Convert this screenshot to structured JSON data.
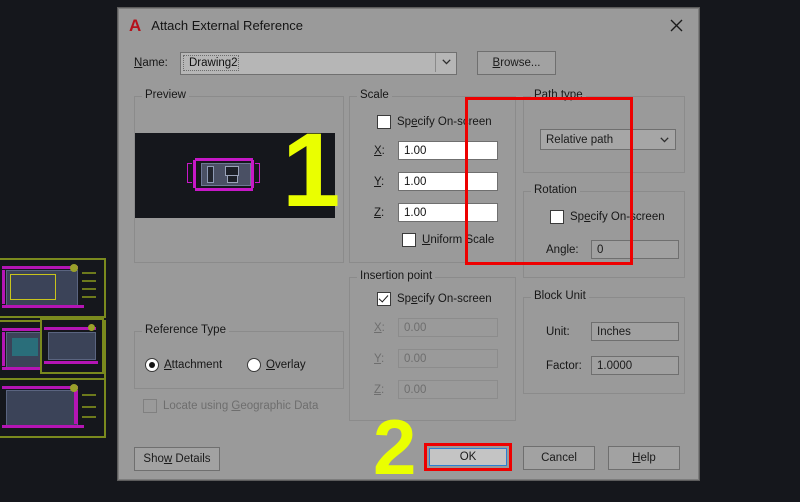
{
  "window": {
    "title": "Attach External Reference",
    "logo_letter": "A",
    "close_icon": "close-icon"
  },
  "name_row": {
    "label": "Name:",
    "label_mnemonic": "N",
    "value": "Drawing2",
    "dropdown_icon": "chevron-down-icon",
    "browse_label": "Browse...",
    "browse_mnemonic": "B"
  },
  "preview": {
    "title": "Preview"
  },
  "reference_type": {
    "title": "Reference Type",
    "attachment_label": "Attachment",
    "overlay_label": "Overlay",
    "selected": "Attachment",
    "geographic_label": "Locate using Geographic Data",
    "geographic_checked": false,
    "geographic_enabled": false
  },
  "scale": {
    "title": "Scale",
    "specify_onscreen_label": "Specify On-screen",
    "specify_onscreen_checked": false,
    "x_label": "X:",
    "x_value": "1.00",
    "y_label": "Y:",
    "y_value": "1.00",
    "z_label": "Z:",
    "z_value": "1.00",
    "uniform_scale_label": "Uniform Scale",
    "uniform_scale_checked": false
  },
  "insertion_point": {
    "title": "Insertion point",
    "specify_onscreen_label": "Specify On-screen",
    "specify_onscreen_checked": true,
    "x_label": "X:",
    "x_value": "0.00",
    "y_label": "Y:",
    "y_value": "0.00",
    "z_label": "Z:",
    "z_value": "0.00",
    "fields_enabled": false
  },
  "path_type": {
    "title": "Path type",
    "selected": "Relative path",
    "dropdown_icon": "chevron-down-icon"
  },
  "rotation": {
    "title": "Rotation",
    "specify_onscreen_label": "Specify On-screen",
    "specify_onscreen_checked": false,
    "angle_label": "Angle:",
    "angle_value": "0",
    "angle_enabled": false
  },
  "block_unit": {
    "title": "Block Unit",
    "unit_label": "Unit:",
    "unit_value": "Inches",
    "factor_label": "Factor:",
    "factor_value": "1.0000"
  },
  "footer": {
    "show_details_label": "Show Details",
    "ok_label": "OK",
    "cancel_label": "Cancel",
    "help_label": "Help"
  },
  "annotations": {
    "step_one": "1",
    "step_two": "2",
    "color": "#eaff00",
    "highlight_color": "#ee0000"
  },
  "colors": {
    "dialog_bg": "#9a9a9a",
    "desktop_bg": "#16181d",
    "accent_red": "#b5121b",
    "focus_blue": "#2b7fd4",
    "cad_green": "#7a8a1e",
    "cad_magenta": "#b515b5"
  }
}
